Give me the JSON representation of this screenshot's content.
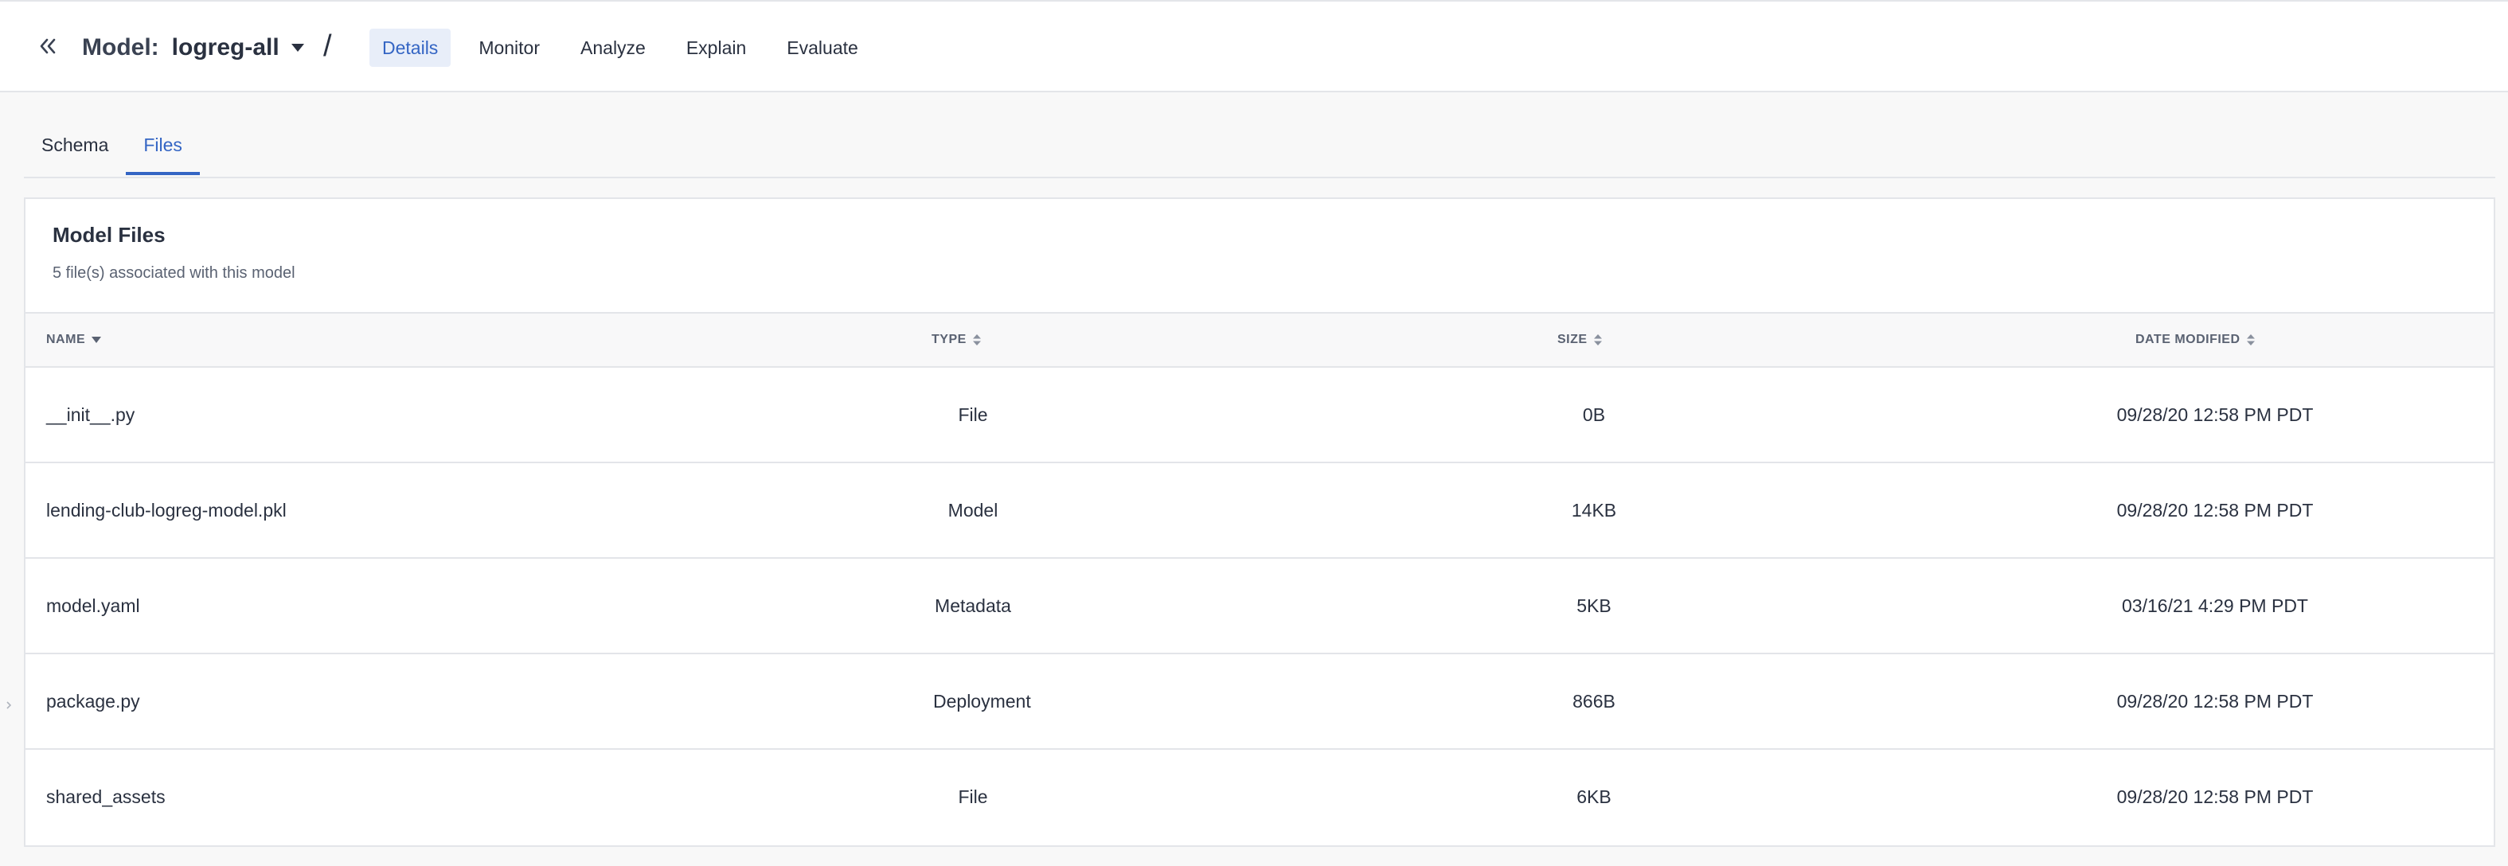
{
  "header": {
    "model_prefix": "Model:",
    "model_name": "logreg-all",
    "separator": "/",
    "nav": [
      {
        "label": "Details",
        "active": true
      },
      {
        "label": "Monitor",
        "active": false
      },
      {
        "label": "Analyze",
        "active": false
      },
      {
        "label": "Explain",
        "active": false
      },
      {
        "label": "Evaluate",
        "active": false
      }
    ]
  },
  "subtabs": [
    {
      "label": "Schema",
      "active": false
    },
    {
      "label": "Files",
      "active": true
    }
  ],
  "panel": {
    "title": "Model Files",
    "subtitle": "5 file(s) associated with this model",
    "columns": {
      "name": "NAME",
      "type": "TYPE",
      "size": "SIZE",
      "date": "DATE MODIFIED"
    },
    "rows": [
      {
        "name": "__init__.py",
        "type": "File",
        "size": "0B",
        "date": "09/28/20 12:58 PM PDT"
      },
      {
        "name": "lending-club-logreg-model.pkl",
        "type": "Model",
        "size": "14KB",
        "date": "09/28/20 12:58 PM PDT"
      },
      {
        "name": "model.yaml",
        "type": "Metadata",
        "size": "5KB",
        "date": "03/16/21 4:29 PM PDT"
      },
      {
        "name": "package.py",
        "type": "Deployment",
        "size": "866B",
        "date": "09/28/20 12:58 PM PDT"
      },
      {
        "name": "shared_assets",
        "type": "File",
        "size": "6KB",
        "date": "09/28/20 12:58 PM PDT"
      }
    ]
  },
  "icons": {
    "collapse": "double-chevron-left-icon",
    "dropdown": "caret-down-icon",
    "sort_active": "sort-desc-icon",
    "sort_inactive": "sort-both-icon",
    "side_handle": "chevron-right-icon"
  },
  "colors": {
    "accent": "#3465c4",
    "active_bg": "#e8eef9",
    "border": "#e3e5e9",
    "text": "#2a3140"
  }
}
